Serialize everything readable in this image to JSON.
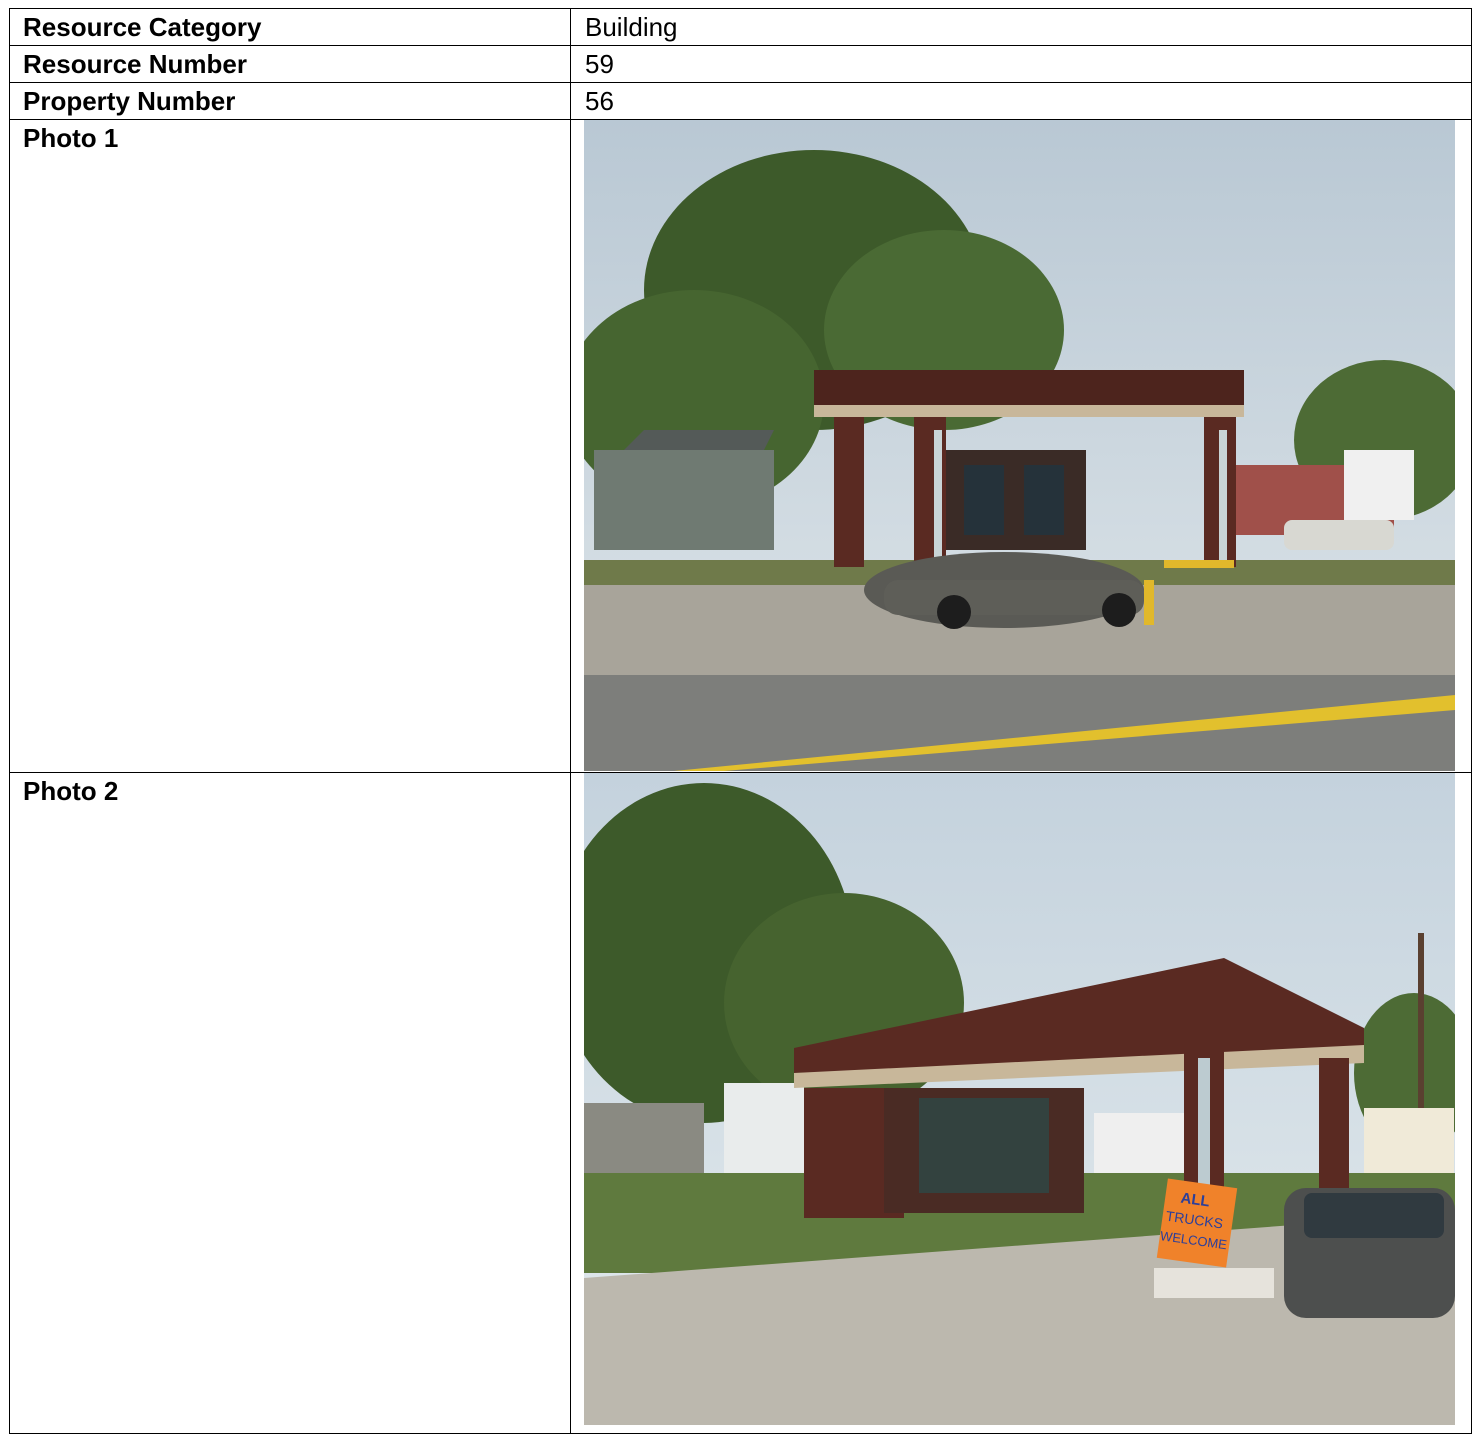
{
  "rows": [
    {
      "label": "Resource Category",
      "value": "Building"
    },
    {
      "label": "Resource Number",
      "value": "59"
    },
    {
      "label": "Property Number",
      "value": "56"
    }
  ],
  "photos": [
    {
      "label": "Photo 1"
    },
    {
      "label": "Photo 2",
      "sign_text": [
        "ALL",
        "TRUCKS",
        "WELCOME"
      ]
    }
  ],
  "colors": {
    "sky": "#c9d6df",
    "brick": "#5a2a22",
    "foliage": "#3f5a2c",
    "road": "#8e8f8c",
    "road_line": "#e3bf2a",
    "sign": "#f0822a",
    "sign_text": "#2c3f9a"
  }
}
